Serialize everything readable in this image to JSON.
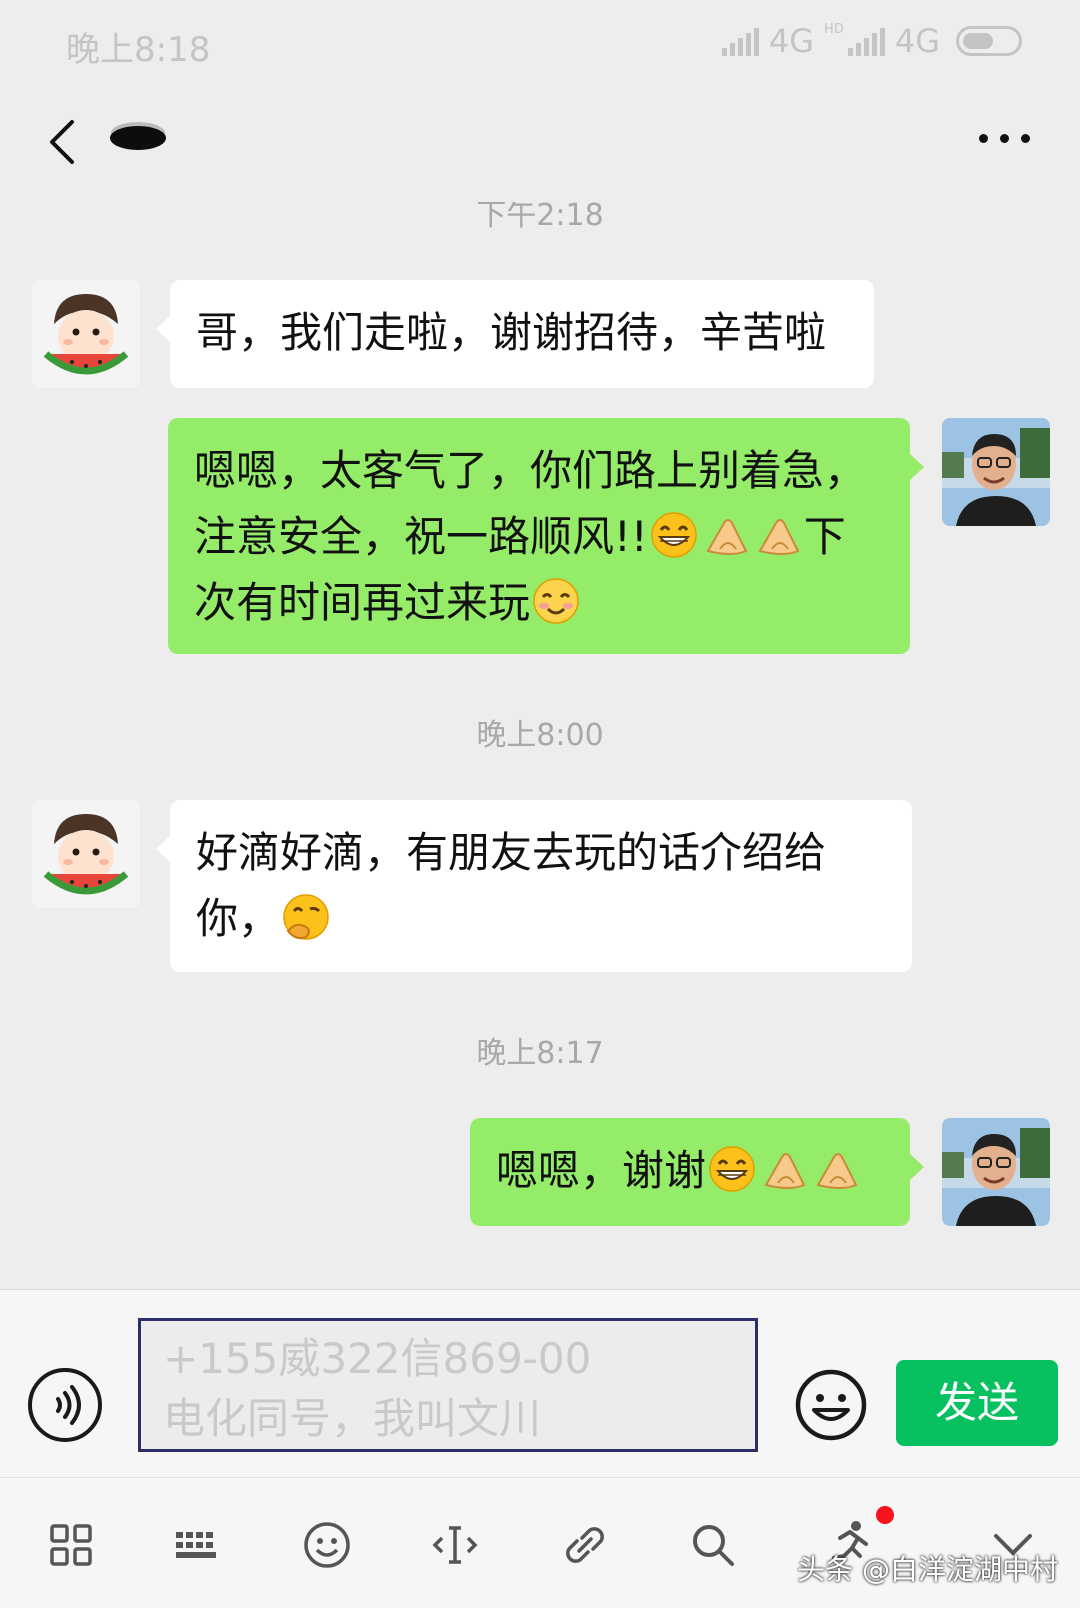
{
  "status_bar": {
    "time": "晚上8:18",
    "network1": "4G",
    "hd": "HD",
    "network2": "4G"
  },
  "header": {
    "contact_name": ""
  },
  "messages": [
    {
      "timestamp": "下午2:18"
    },
    {
      "sender": "contact",
      "text": "哥，我们走啦，谢谢招待，辛苦啦"
    },
    {
      "sender": "me",
      "line1": "嗯嗯，太客气了，你们路上别着急，",
      "line2a": "注意安全，祝一路顺风!!",
      "line2b": "下",
      "line3": "次有时间再过来玩"
    },
    {
      "timestamp": "晚上8:00"
    },
    {
      "sender": "contact",
      "line1": "好滴好滴，有朋友去玩的话介绍给",
      "line2": "你，"
    },
    {
      "timestamp": "晚上8:17"
    },
    {
      "sender": "me",
      "text": "嗯嗯，谢谢"
    }
  ],
  "input": {
    "line1": "+155威322信869-00",
    "line2": "电化同号，我叫文川"
  },
  "send_label": "发送",
  "watermark": "头条 @白洋淀湖中村",
  "icons": [
    "back-icon",
    "more-icon",
    "voice-icon",
    "smiley-icon",
    "grid-icon",
    "keyboard-icon",
    "emoji-icon",
    "text-cursor-icon",
    "link-icon",
    "search-icon",
    "run-icon",
    "collapse-icon"
  ],
  "colors": {
    "outgoing_bubble": "#95ec69",
    "send_button": "#07c160",
    "background": "#ededed"
  }
}
